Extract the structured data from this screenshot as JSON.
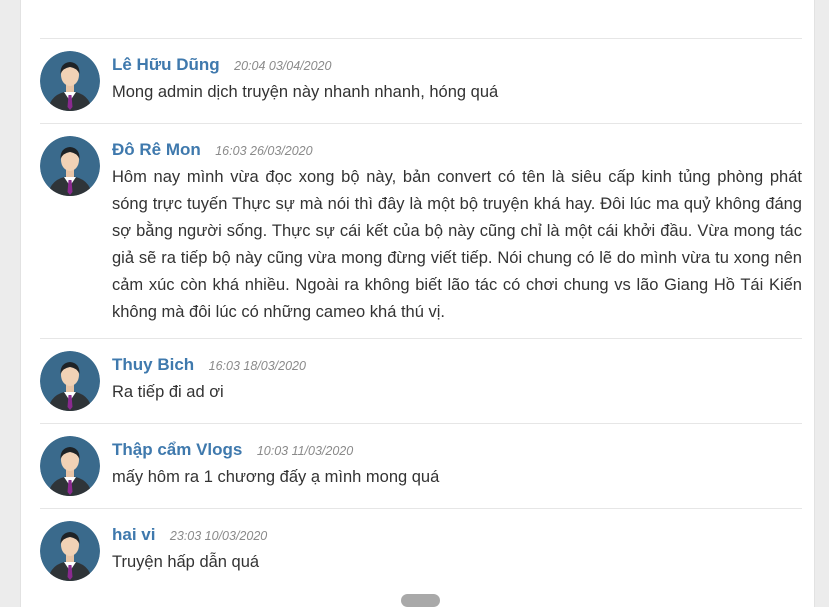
{
  "comments": [
    {
      "author": "Lê Hữu Dũng",
      "time": "20:04 03/04/2020",
      "text": "Mong admin dịch truyện này nhanh nhanh, hóng quá"
    },
    {
      "author": "Đô Rê Mon",
      "time": "16:03 26/03/2020",
      "text": "Hôm nay mình vừa đọc xong bộ này, bản convert có tên là siêu cấp kinh tủng phòng phát sóng trực tuyến Thực sự mà nói thì đây là một bộ truyện khá hay. Đôi lúc ma quỷ không đáng sợ bằng người sống. Thực sự cái kết của bộ này cũng chỉ là một cái khởi đầu. Vừa mong tác giả sẽ ra tiếp bộ này cũng vừa mong đừng viết tiếp. Nói chung có lẽ do mình vừa tu xong nên cảm xúc còn khá nhiều. Ngoài ra không biết lão tác có chơi chung vs lão Giang Hồ Tái Kiến không mà đôi lúc có những cameo khá thú vị."
    },
    {
      "author": "Thuy Bich",
      "time": "16:03 18/03/2020",
      "text": "Ra tiếp đi ad ơi"
    },
    {
      "author": "Thập cẩm Vlogs",
      "time": "10:03 11/03/2020",
      "text": "mấy hôm ra 1 chương đấy ạ mình mong quá"
    },
    {
      "author": "hai vi",
      "time": "23:03 10/03/2020",
      "text": "Truyện hấp dẫn quá"
    }
  ],
  "colors": {
    "author": "#3f79ad",
    "time": "#8a8a8a",
    "text": "#333333",
    "avatar_bg": "#3a6a8c",
    "divider": "#e6e6e6"
  },
  "icons": {
    "avatar": "user-avatar-icon",
    "scroll": "scroll-handle"
  }
}
